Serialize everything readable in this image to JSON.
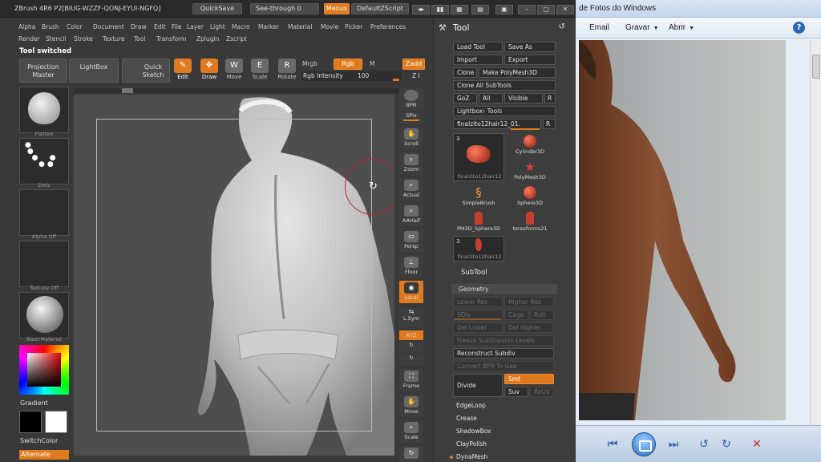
{
  "zbrush": {
    "title": "ZBrush  4R6  P2[BIUG-WZZF-QONJ-EYUI-NGFQ]",
    "quicksave": "QuickSave",
    "seethrough": "See-through  0",
    "menus": "Menus",
    "default_zscript": "DefaultZScript",
    "menu_row1": [
      "Alpha",
      "Brush",
      "Color",
      "Document",
      "Draw",
      "Edit",
      "File",
      "Layer",
      "Light",
      "Macro",
      "Marker",
      "Material",
      "Movie",
      "Picker",
      "Preferences"
    ],
    "menu_row2": [
      "Render",
      "Stencil",
      "Stroke",
      "Texture",
      "Tool",
      "Transform",
      "Zplugin",
      "Zscript"
    ],
    "status_message": "Tool switched",
    "toolbar": {
      "projection_master": "Projection Master",
      "lightbox": "LightBox",
      "quick_sketch": "Quick Sketch",
      "edit": "Edit",
      "draw": "Draw",
      "move": "Move",
      "scale": "Scale",
      "rotate": "Rotate",
      "mrgb": "Mrgb",
      "rgb": "Rgb",
      "m": "M",
      "zadd": "Zadd",
      "rgb_intensity_label": "Rgb  Intensity",
      "rgb_intensity_value": "100",
      "z_indicator": "Z I"
    },
    "left_shelf": {
      "brush_label": "Flatten",
      "stroke_label": "Dots",
      "alpha_label": "Alpha  Off",
      "texture_label": "Texture  Off",
      "material_label": "BasicMaterial",
      "gradient_label": "Gradient",
      "switchcolor_label": "SwitchColor",
      "alternate_label": "Alternate"
    },
    "right_rail": [
      "BPR",
      "SPix",
      "Scroll",
      "Zoom",
      "Actual",
      "AAHalf",
      "Persp",
      "Floor",
      "Local",
      "L.Sym",
      "XYZ",
      "Frame",
      "Move",
      "Scale"
    ],
    "tool_panel": {
      "title": "Tool",
      "load_tool": "Load Tool",
      "save_as": "Save As",
      "import": "Import",
      "export": "Export",
      "clone": "Clone",
      "make_polymesh": "Make PolyMesh3D",
      "clone_all_subtools": "Clone  All  SubTools",
      "goz": "GoZ",
      "all": "All",
      "visible": "Visible",
      "r": "R",
      "lightbox_tools": "Lightbox› Tools",
      "current_tool": "finalzito12hair12_01.",
      "grid_items": [
        {
          "label": "finalzito12hair12",
          "count": "3"
        },
        {
          "label": "Cylinder3D"
        },
        {
          "label": "PolyMesh3D"
        },
        {
          "label": "SimpleBrush"
        },
        {
          "label": "Sphere3D"
        },
        {
          "label": "PM3D_Sphere3D"
        },
        {
          "label": "torsoforms21"
        },
        {
          "label": "finalzito12hair12",
          "count": "3"
        }
      ],
      "subtool": "SubTool",
      "geometry": "Geometry",
      "lower_res": "Lower  Res",
      "higher_res": "Higher  Res",
      "sdiv": "SDiv",
      "cage": "Cage",
      "rstr": "Rstr",
      "del_lower": "Del  Lower",
      "del_higher": "Del  Higher",
      "freeze_subdivision_levels": "Freeze  SubDivision  Levels",
      "reconstruct_subdiv": "Reconstruct  Subdiv",
      "convert_bpr_to_geo": "Convert  BPR  To  Geo",
      "divide": "Divide",
      "smt": "Smt",
      "suv": "Suv",
      "reuv": "ReUV",
      "edgeloop": "EdgeLoop",
      "crease": "Crease",
      "shadowbox": "ShadowBox",
      "claypolish": "ClayPolish",
      "dynamesh": "DynaMesh"
    }
  },
  "viewer": {
    "title": "de Fotos do Windows",
    "menu": {
      "email": "Email",
      "gravar": "Gravar",
      "abrir": "Abrir"
    },
    "help": "?"
  },
  "colors": {
    "accent": "#e07a1f",
    "panel": "#3d3d3d",
    "viewer_blue": "#2c5fad"
  }
}
